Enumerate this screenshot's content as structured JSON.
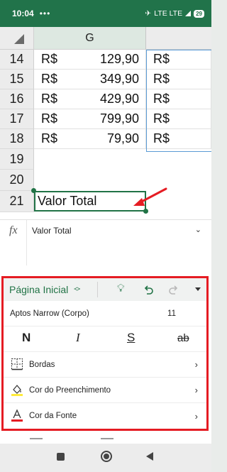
{
  "status_bar": {
    "time": "10:04",
    "indicators": "LTE  LTE",
    "battery": "29"
  },
  "sheet": {
    "column_headers": [
      "G",
      ""
    ],
    "rows": [
      {
        "num": "14",
        "currency": "R$",
        "amount": "129,90",
        "next_col": "R$"
      },
      {
        "num": "15",
        "currency": "R$",
        "amount": "349,90",
        "next_col": "R$"
      },
      {
        "num": "16",
        "currency": "R$",
        "amount": "429,90",
        "next_col": "R$"
      },
      {
        "num": "17",
        "currency": "R$",
        "amount": "799,90",
        "next_col": "R$"
      },
      {
        "num": "18",
        "currency": "R$",
        "amount": "79,90",
        "next_col": "R$"
      },
      {
        "num": "19"
      },
      {
        "num": "20"
      },
      {
        "num": "21",
        "selected_text": "Valor Total"
      }
    ]
  },
  "formula_bar": {
    "label": "fx",
    "value": "Valor Total"
  },
  "ribbon": {
    "tab_title": "Página Inicial",
    "font_name": "Aptos Narrow (Corpo)",
    "font_size": "11",
    "format_buttons": [
      "N",
      "I",
      "S",
      "ab"
    ],
    "options": [
      {
        "label": "Bordas",
        "icon": "borders-icon"
      },
      {
        "label": "Cor do Preenchimento",
        "icon": "fill-color-icon"
      },
      {
        "label": "Cor da Fonte",
        "icon": "font-color-icon"
      }
    ]
  },
  "colors": {
    "excel_green": "#21734a",
    "highlight_red": "#e51c23",
    "fill_yellow": "#ffeb3b"
  }
}
